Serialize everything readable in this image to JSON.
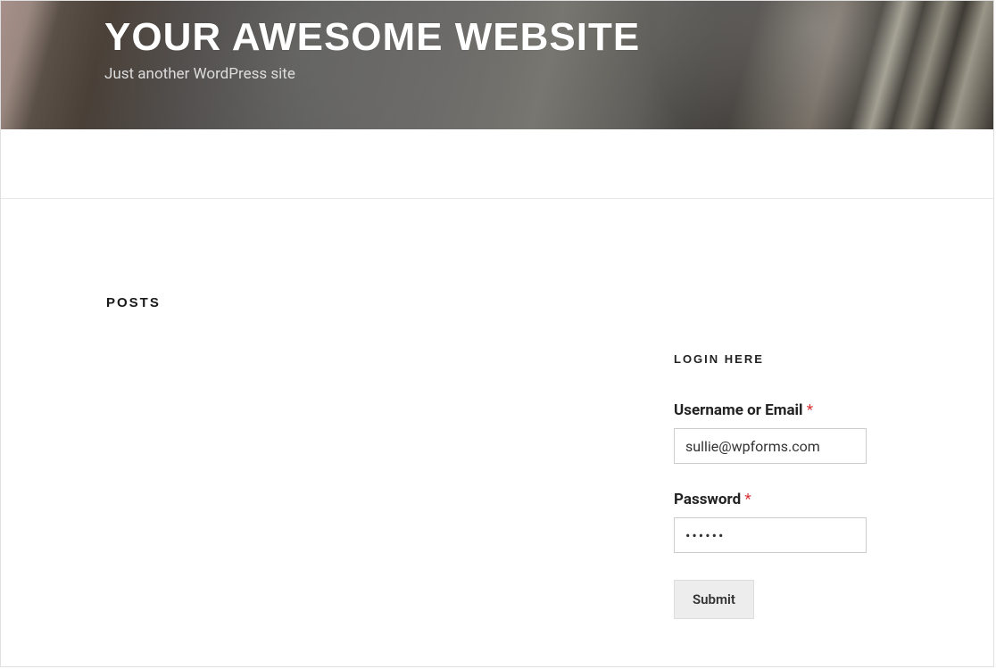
{
  "header": {
    "site_title": "YOUR AWESOME WEBSITE",
    "tagline": "Just another WordPress site"
  },
  "main": {
    "posts_heading": "POSTS"
  },
  "sidebar": {
    "widget_title": "LOGIN HERE",
    "form": {
      "username_label": "Username or Email",
      "username_value": "sullie@wpforms.com",
      "password_label": "Password",
      "password_value": "••••••",
      "required_mark": "*",
      "submit_label": "Submit"
    }
  }
}
